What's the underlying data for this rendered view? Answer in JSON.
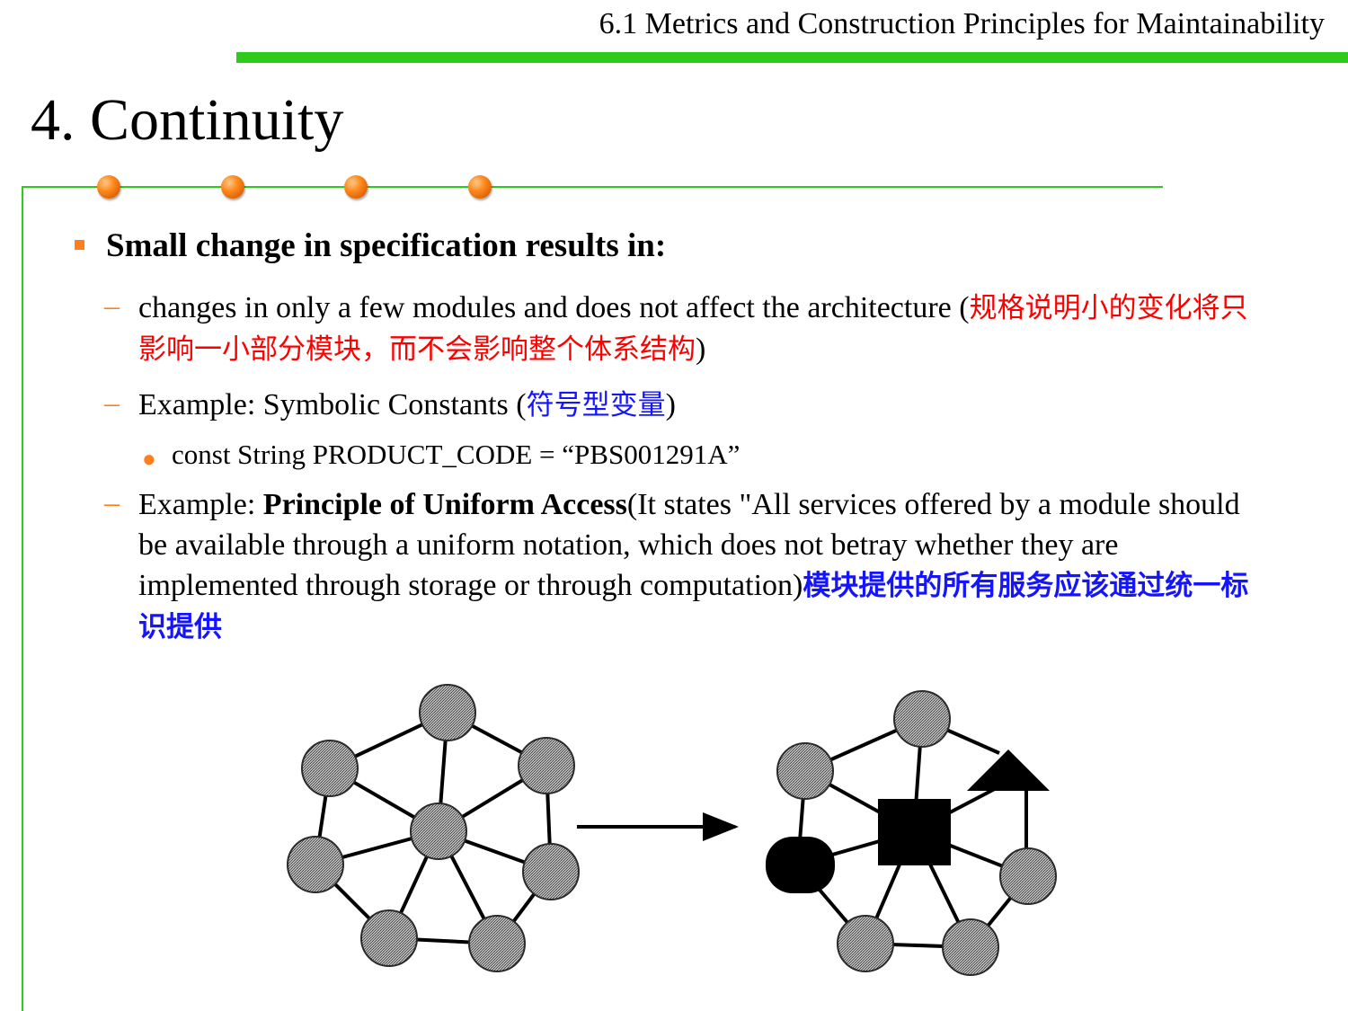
{
  "header": {
    "title": "6.1 Metrics and Construction Principles for Maintainability"
  },
  "slide": {
    "title": "4. Continuity"
  },
  "content": {
    "point": "Small change in specification results in:",
    "sub1_en": "changes in only a few modules and does not affect the architecture (",
    "sub1_zh": "规格说明小的变化将只影响一小部分模块，而不会影响整个体系结构",
    "sub1_close": ")",
    "sub2_en": "Example: Symbolic Constants (",
    "sub2_zh": "符号型变量",
    "sub2_close": ")",
    "sub2_item": "const String PRODUCT_CODE = “PBS001291A”",
    "sub3_prefix": "Example: ",
    "sub3_bold": "Principle of Uniform Access",
    "sub3_rest": "(It states \"All services offered by a module should be available through a uniform notation, which does not betray whether they are implemented through storage or through computation)",
    "sub3_zh": "模块提供的所有服务应该通过统一标识提供"
  },
  "colors": {
    "accent_green": "#2ecb1a",
    "bullet_orange": "#ff7f1e",
    "zh_red": "#ff0000",
    "zh_blue": "#1414ff"
  },
  "icons": [
    "bullet-square-icon",
    "dash-icon",
    "bullet-dot-icon",
    "orange-dot-icon"
  ]
}
